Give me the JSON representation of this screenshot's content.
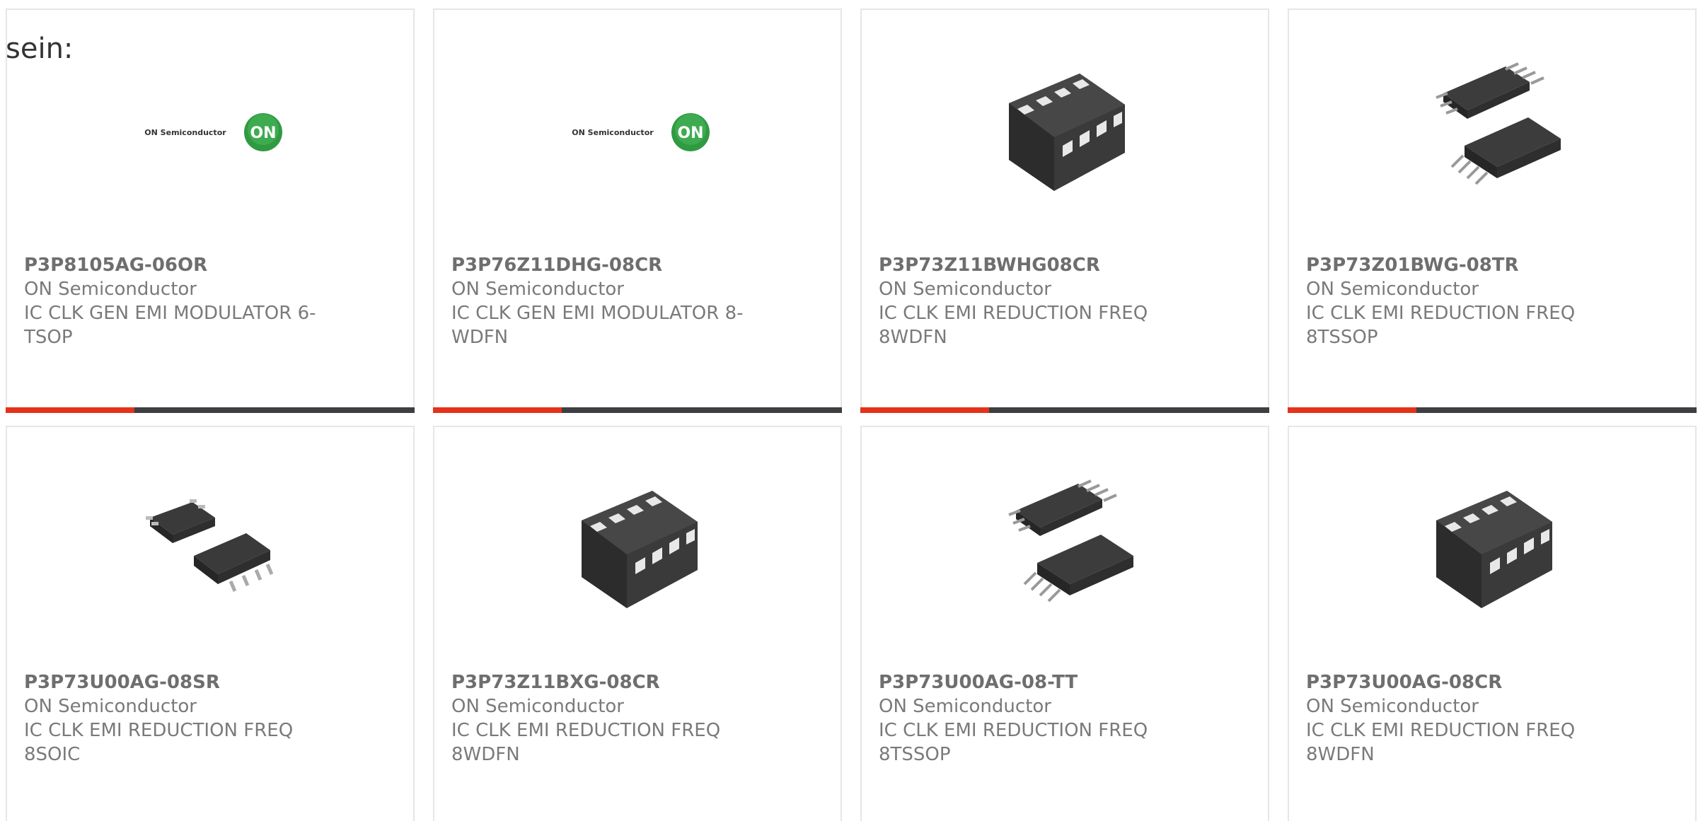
{
  "lead_text": "sein:",
  "colors": {
    "accent": "#e4321b",
    "bar_dark": "#3d3f42",
    "text": "#7a7a7a",
    "logo_green": "#2f9a42"
  },
  "products": [
    {
      "part": "P3P8105AG-06OR",
      "maker": "ON Semiconductor",
      "desc": "IC CLK GEN EMI MODULATOR 6-TSOP",
      "image": "on-semiconductor-logo",
      "logo_text": "ON Semiconductor",
      "logo_mark": "ON"
    },
    {
      "part": "P3P76Z11DHG-08CR",
      "maker": "ON Semiconductor",
      "desc": "IC CLK GEN EMI MODULATOR 8-WDFN",
      "image": "on-semiconductor-logo",
      "logo_text": "ON Semiconductor",
      "logo_mark": "ON"
    },
    {
      "part": "P3P73Z11BWHG08CR",
      "maker": "ON Semiconductor",
      "desc": "IC CLK EMI REDUCTION FREQ 8WDFN",
      "image": "wdfn-package"
    },
    {
      "part": "P3P73Z01BWG-08TR",
      "maker": "ON Semiconductor",
      "desc": "IC CLK EMI REDUCTION FREQ 8TSSOP",
      "image": "tssop-package"
    },
    {
      "part": "P3P73U00AG-08SR",
      "maker": "ON Semiconductor",
      "desc": "IC CLK EMI REDUCTION FREQ 8SOIC",
      "image": "soic-package"
    },
    {
      "part": "P3P73Z11BXG-08CR",
      "maker": "ON Semiconductor",
      "desc": "IC CLK EMI REDUCTION FREQ 8WDFN",
      "image": "wdfn-package"
    },
    {
      "part": "P3P73U00AG-08-TT",
      "maker": "ON Semiconductor",
      "desc": "IC CLK EMI REDUCTION FREQ 8TSSOP",
      "image": "tssop-package"
    },
    {
      "part": "P3P73U00AG-08CR",
      "maker": "ON Semiconductor",
      "desc": "IC CLK EMI REDUCTION FREQ 8WDFN",
      "image": "wdfn-package"
    }
  ]
}
